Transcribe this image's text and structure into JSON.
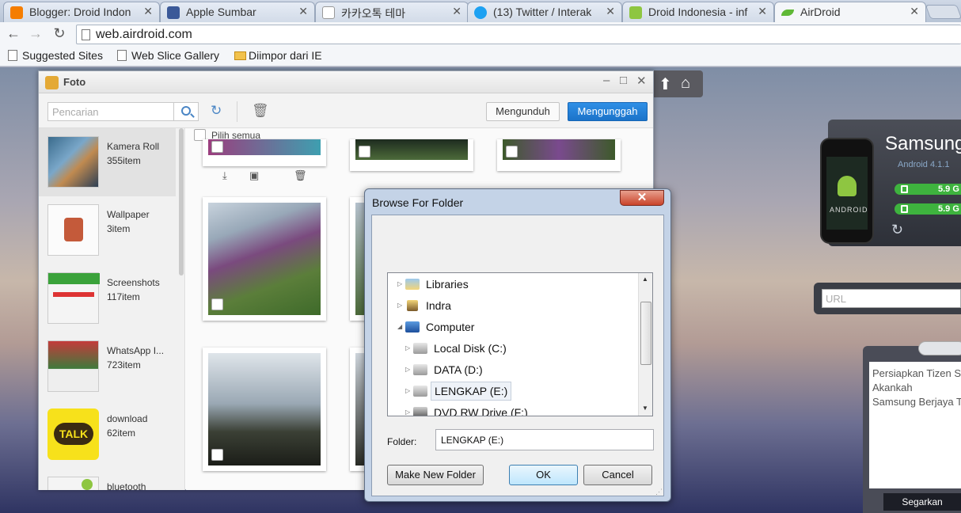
{
  "browser": {
    "tabs": [
      {
        "label": "Blogger: Droid Indon",
        "color": "#f57d00"
      },
      {
        "label": "Apple Sumbar",
        "color": "#3b5998"
      },
      {
        "label": "카카오톡 테마",
        "color": "#eeeeee"
      },
      {
        "label": "(13) Twitter / Interak",
        "color": "#1da1f2"
      },
      {
        "label": "Droid Indonesia - inf",
        "color": "#8ec641"
      },
      {
        "label": "AirDroid",
        "color": "#5fb836"
      }
    ],
    "url": "web.airdroid.com",
    "bookmarks": [
      "Suggested Sites",
      "Web Slice Gallery",
      "Diimpor dari IE"
    ]
  },
  "foto": {
    "title": "Foto",
    "search_placeholder": "Pencarian",
    "download_label": "Mengunduh",
    "upload_label": "Mengunggah",
    "select_all": "Pilih semua",
    "albums": [
      {
        "name": "Kamera Roll",
        "count": "355item"
      },
      {
        "name": "Wallpaper",
        "count": "3item"
      },
      {
        "name": "Screenshots",
        "count": "117item"
      },
      {
        "name": "WhatsApp I...",
        "count": "723item"
      },
      {
        "name": "download",
        "count": "62item"
      },
      {
        "name": "bluetooth",
        "count": ""
      }
    ],
    "talk_logo": "TALK"
  },
  "dialog": {
    "title": "Browse For Folder",
    "close_glyph": "✕",
    "tree": [
      "Libraries",
      "Indra",
      "Computer",
      "Local Disk (C:)",
      "DATA (D:)",
      "LENGKAP (E:)",
      "DVD RW Drive (F:)"
    ],
    "folder_label": "Folder:",
    "folder_value": "LENGKAP (E:)",
    "make_new_folder": "Make New Folder",
    "ok": "OK",
    "cancel": "Cancel"
  },
  "device": {
    "name": "Samsung",
    "android_version": "Android 4.1.1",
    "storage": [
      "5.9 G",
      "5.9 G"
    ],
    "phone_logo": "ANDROID"
  },
  "url_placeholder": "URL",
  "notes": {
    "lines": [
      "Persiapkan Tizen S",
      "Akankah",
      "Samsung Berjaya T"
    ],
    "refresh": "Segarkan"
  },
  "colors": {
    "accent": "#1b73c9",
    "android_green": "#3eb33e"
  }
}
